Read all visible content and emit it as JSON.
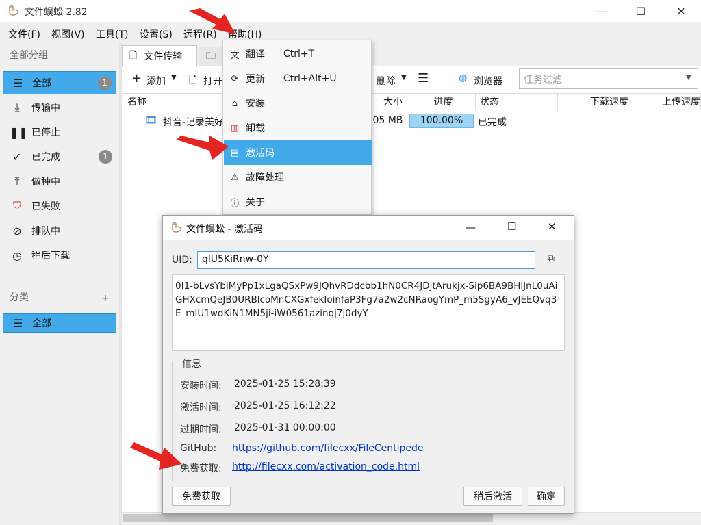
{
  "window": {
    "title": "文件蜈蚣 2.82",
    "minimize": "—",
    "maximize": "☐",
    "close": "✕"
  },
  "menubar": [
    "文件(F)",
    "视图(V)",
    "工具(T)",
    "设置(S)",
    "远程(R)",
    "帮助(H)"
  ],
  "sidebar": {
    "groups_header": "全部分组",
    "items": [
      {
        "label": "全部",
        "icon": "list-icon",
        "badge": "1"
      },
      {
        "label": "传输中",
        "icon": "download-icon"
      },
      {
        "label": "已停止",
        "icon": "pause-icon"
      },
      {
        "label": "已完成",
        "icon": "check-icon",
        "badge": "1"
      },
      {
        "label": "做种中",
        "icon": "upload-icon"
      },
      {
        "label": "已失败",
        "icon": "shield-error-icon"
      },
      {
        "label": "排队中",
        "icon": "compass-icon"
      },
      {
        "label": "稍后下载",
        "icon": "clock-icon"
      }
    ],
    "category_header": "分类",
    "category_add": "+",
    "category_item": "全部"
  },
  "tabs": {
    "active": "文件传输"
  },
  "toolbar": {
    "add": "添加",
    "open": "打开",
    "delete": "删除",
    "browser": "浏览器",
    "filter_placeholder": "任务过滤"
  },
  "columns": {
    "name": "名称",
    "size": "大小",
    "progress": "进度",
    "status": "状态",
    "down_speed": "下载速度",
    "up_speed": "上传速度"
  },
  "row": {
    "name": "抖音-记录美好",
    "size": ".05 MB",
    "progress": "100.00%",
    "status": "已完成"
  },
  "help_menu": [
    {
      "label": "翻译",
      "shortcut": "Ctrl+T",
      "icon": "translate-icon"
    },
    {
      "label": "更新",
      "shortcut": "Ctrl+Alt+U",
      "icon": "refresh-icon"
    },
    {
      "label": "安装",
      "shortcut": "",
      "icon": "home-icon"
    },
    {
      "label": "卸载",
      "shortcut": "",
      "icon": "uninstall-icon"
    },
    {
      "label": "激活码",
      "shortcut": "",
      "icon": "document-icon"
    },
    {
      "label": "故障处理",
      "shortcut": "",
      "icon": "alert-icon"
    },
    {
      "label": "关于",
      "shortcut": "",
      "icon": "info-icon"
    }
  ],
  "dialog": {
    "title": "文件蜈蚣 - 激活码",
    "uid_label": "UID:",
    "uid_value": "qlU5KiRnw-0Y",
    "code": "0I1-bLvsYbiMyPp1xLgaQSxPw9JQhvRDdcbb1hN0CR4JDjtArukjx-Sip6BA9BHlJnL0uAiGHXcmQeJB0URBlcoMnCXGxfekIoinfaP3Fg7a2w2cNRaogYmP_m5SgyA6_vJEEQvq3E_mIU1wdKiN1MN5ji-iW0561azinqj7j0dyY",
    "info_header": "信息",
    "install_label": "安装时间:",
    "install_value": "2025-01-25 15:28:39",
    "activate_label": "激活时间:",
    "activate_value": "2025-01-25 16:12:22",
    "expire_label": "过期时间:",
    "expire_value": "2025-01-31 00:00:00",
    "github_label": "GitHub:",
    "github_link": "https://github.com/filecxx/FileCentipede",
    "free_label": "免费获取:",
    "free_link": "http://filecxx.com/activation_code.html",
    "btn_free": "免费获取",
    "btn_later": "稍后激活",
    "btn_ok": "确定"
  }
}
